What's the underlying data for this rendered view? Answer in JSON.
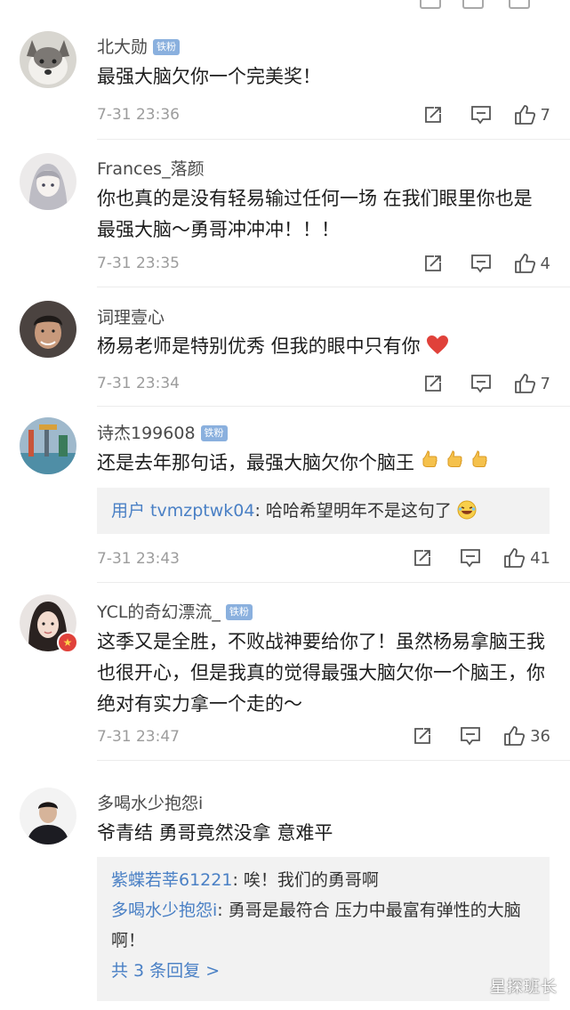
{
  "comments": [
    {
      "username": "北大勋",
      "badge": "铁粉",
      "text": "最强大脑欠你一个完美奖！",
      "time": "7-31 23:36",
      "likes": "7"
    },
    {
      "username": "Frances_落颜",
      "text": "你也真的是没有轻易输过任何一场 在我们眼里你也是最强大脑～勇哥冲冲冲！！！",
      "time": "7-31 23:35",
      "likes": "4"
    },
    {
      "username": "词理壹心",
      "text": "杨易老师是特别优秀 但我的眼中只有你",
      "time": "7-31 23:34",
      "likes": "7"
    },
    {
      "username": "诗杰199608",
      "badge": "铁粉",
      "text": "还是去年那句话，最强大脑欠你个脑王",
      "reply_user": "用户 tvmzptwk04",
      "reply_text": ": 哈哈希望明年不是这句了",
      "time": "7-31 23:43",
      "likes": "41"
    },
    {
      "username": "YCL的奇幻漂流_",
      "badge": "铁粉",
      "text": "这季又是全胜，不败战神要给你了！虽然杨易拿脑王我也很开心，但是我真的觉得最强大脑欠你一个脑王，你绝对有实力拿一个走的～",
      "time": "7-31 23:47",
      "likes": "36"
    },
    {
      "username": "多喝水少抱怨i",
      "text": "爷青结 勇哥竟然没拿 意难平",
      "replies": [
        {
          "user": "紫蝶若莘61221",
          "text": ": 唉！我们的勇哥啊"
        },
        {
          "user": "多喝水少抱怨i",
          "text": ": 勇哥是最符合 压力中最富有弹性的大脑啊！"
        }
      ],
      "more_replies": "共 3 条回复 >"
    }
  ],
  "watermark": "星探班长",
  "colors": {
    "link": "#4a80c5",
    "badge": "#8ab0de",
    "heart": "#e0413a"
  }
}
